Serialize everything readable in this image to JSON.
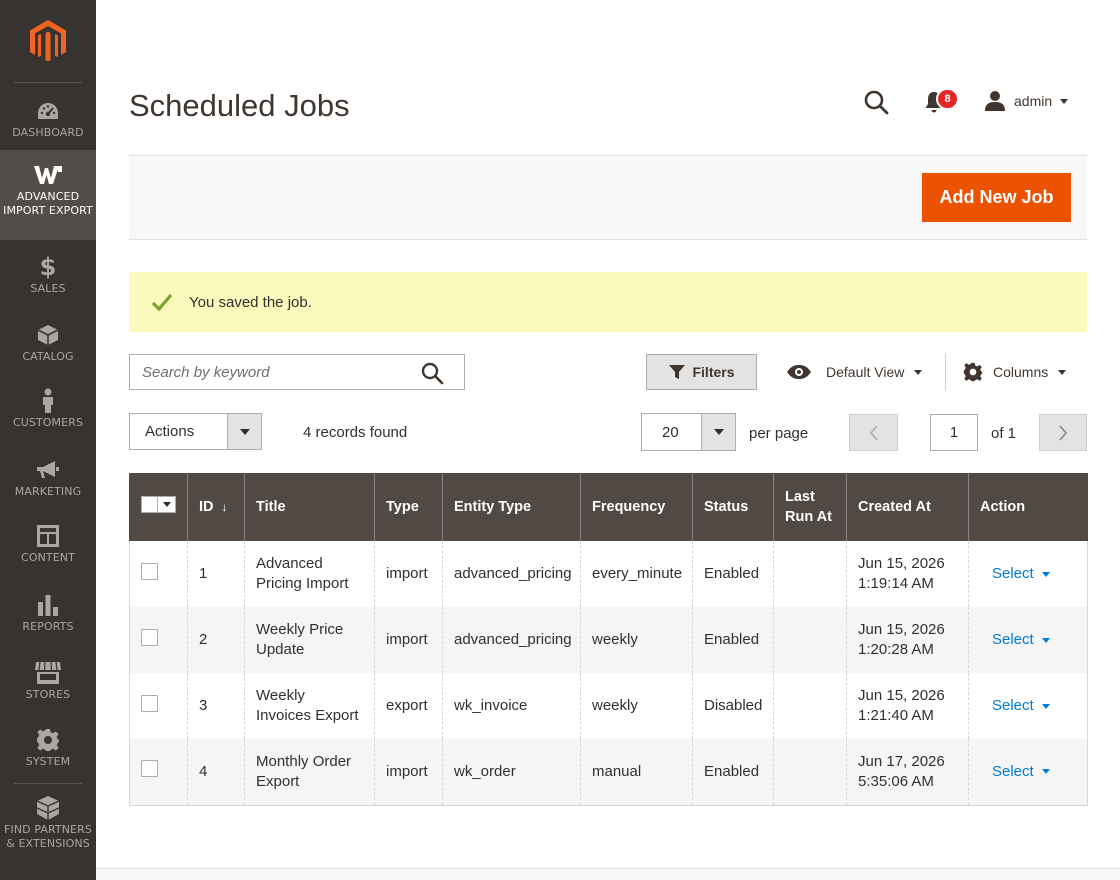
{
  "sidebar": {
    "logo": "magento-logo",
    "items": [
      {
        "label": "DASHBOARD",
        "icon": "dashboard-icon"
      },
      {
        "label": "ADVANCED IMPORT EXPORT",
        "icon": "import-export-icon",
        "active": true
      },
      {
        "label": "SALES",
        "icon": "dollar-icon"
      },
      {
        "label": "CATALOG",
        "icon": "box-icon"
      },
      {
        "label": "CUSTOMERS",
        "icon": "person-icon"
      },
      {
        "label": "MARKETING",
        "icon": "megaphone-icon"
      },
      {
        "label": "CONTENT",
        "icon": "layout-icon"
      },
      {
        "label": "REPORTS",
        "icon": "bar-chart-icon"
      },
      {
        "label": "STORES",
        "icon": "store-icon"
      },
      {
        "label": "SYSTEM",
        "icon": "gear-icon"
      },
      {
        "label": "FIND PARTNERS & EXTENSIONS",
        "icon": "cubes-icon"
      }
    ]
  },
  "header": {
    "title": "Scheduled Jobs",
    "notifications_count": "8",
    "user": "admin"
  },
  "action_bar": {
    "add_label": "Add New Job"
  },
  "message": {
    "text": "You saved the job."
  },
  "toolbar": {
    "search_placeholder": "Search by keyword",
    "filters_label": "Filters",
    "view_label": "Default View",
    "columns_label": "Columns",
    "actions_label": "Actions",
    "records_found": "4 records found",
    "per_page_value": "20",
    "per_page_label": "per page",
    "current_page": "1",
    "page_of": "of 1"
  },
  "grid": {
    "columns": [
      "ID",
      "Title",
      "Type",
      "Entity Type",
      "Frequency",
      "Status",
      "Last Run At",
      "Created At",
      "Action"
    ],
    "rows": [
      {
        "id": "1",
        "title": "Advanced Pricing Import",
        "type": "import",
        "entity": "advanced_pricing",
        "frequency": "every_minute",
        "status": "Enabled",
        "last_run": "",
        "created_date": "Jun 15, 2026",
        "created_time": "1:19:14 AM",
        "action": "Select"
      },
      {
        "id": "2",
        "title": "Weekly Price Update",
        "type": "import",
        "entity": "advanced_pricing",
        "frequency": "weekly",
        "status": "Enabled",
        "last_run": "",
        "created_date": "Jun 15, 2026",
        "created_time": "1:20:28 AM",
        "action": "Select"
      },
      {
        "id": "3",
        "title": "Weekly Invoices Export",
        "type": "export",
        "entity": "wk_invoice",
        "frequency": "weekly",
        "status": "Disabled",
        "last_run": "",
        "created_date": "Jun 15, 2026",
        "created_time": "1:21:40 AM",
        "action": "Select"
      },
      {
        "id": "4",
        "title": "Monthly Order Export",
        "type": "import",
        "entity": "wk_order",
        "frequency": "manual",
        "status": "Enabled",
        "last_run": "",
        "created_date": "Jun 17, 2026",
        "created_time": "5:35:06 AM",
        "action": "Select"
      }
    ]
  },
  "colors": {
    "sidebar_bg": "#373330",
    "accent": "#eb5202",
    "grid_header": "#514943",
    "message_bg": "#fafabc",
    "link": "#007bdb"
  }
}
